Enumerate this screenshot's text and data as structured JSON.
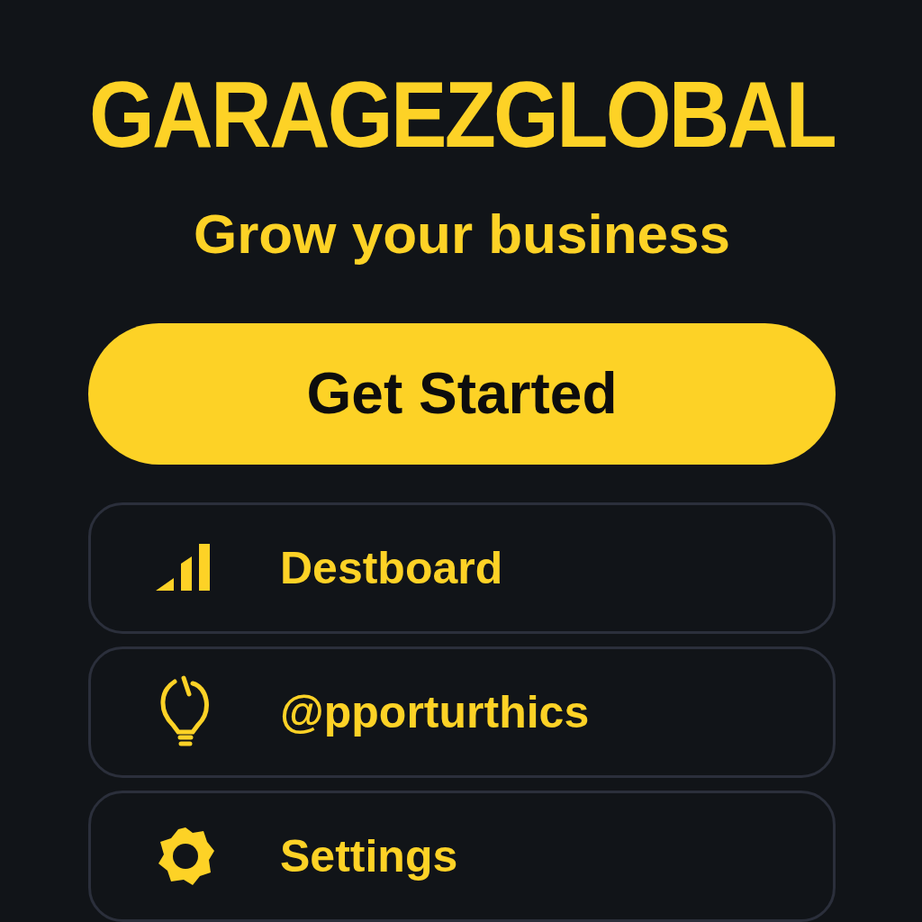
{
  "brand": "GARAGEZGLOBAL",
  "tagline": "Grow your business",
  "cta": {
    "label": "Get Started"
  },
  "menu": [
    {
      "kind": "chart",
      "label": "Destboard"
    },
    {
      "kind": "bulb",
      "label": "@pporturthics"
    },
    {
      "kind": "gear",
      "label": "Settings"
    }
  ]
}
